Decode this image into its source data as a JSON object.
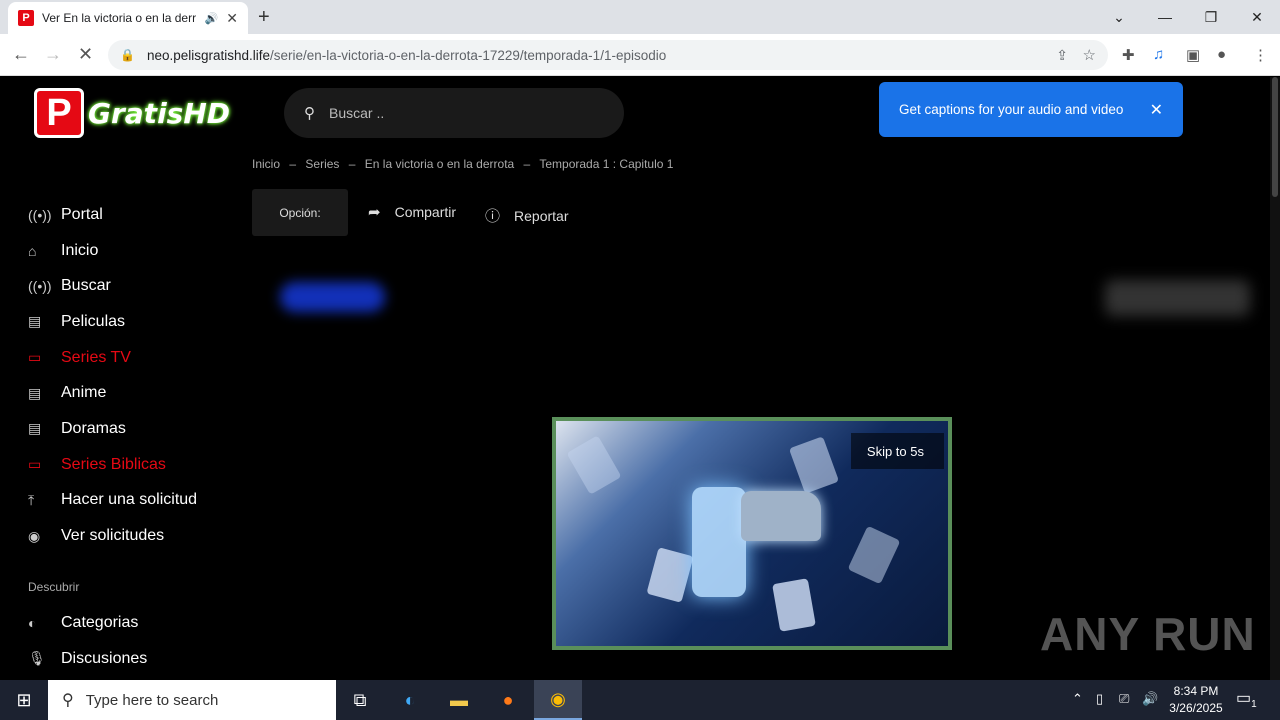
{
  "browser": {
    "tab_title": "Ver En la victoria o en la derr",
    "favicon_letter": "P",
    "url_host": "neo.pelisgratishd.life",
    "url_path": "/serie/en-la-victoria-o-en-la-derrota-17229/temporada-1/1-episodio"
  },
  "site": {
    "logo_letter": "P",
    "logo_text": "GratisHD",
    "search_placeholder": "Buscar .."
  },
  "popup": {
    "text": "Get captions for your audio and video"
  },
  "breadcrumb": [
    "Inicio",
    "–",
    "Series",
    "–",
    "En la victoria o en la derrota",
    "–",
    "Temporada 1 : Capitulo 1"
  ],
  "actions": {
    "option_label": "Opción:",
    "share_label": "Compartir",
    "report_label": "Reportar"
  },
  "sidebar": {
    "items": [
      {
        "label": "Portal",
        "icon": "broadcast-icon",
        "active": false
      },
      {
        "label": "Inicio",
        "icon": "home-icon",
        "active": false
      },
      {
        "label": "Buscar",
        "icon": "broadcast-icon",
        "active": false
      },
      {
        "label": "Peliculas",
        "icon": "film-icon",
        "active": false
      },
      {
        "label": "Series TV",
        "icon": "tv-icon",
        "active": true
      },
      {
        "label": "Anime",
        "icon": "film-icon",
        "active": false
      },
      {
        "label": "Doramas",
        "icon": "film-icon",
        "active": false
      },
      {
        "label": "Series Biblicas",
        "icon": "tv-icon",
        "active": true
      },
      {
        "label": "Hacer una solicitud",
        "icon": "upload-icon",
        "active": false
      },
      {
        "label": "Ver solicitudes",
        "icon": "eye-icon",
        "active": false
      }
    ],
    "section_label": "Descubrir",
    "discover": [
      {
        "label": "Categorias",
        "icon": "halfcircle-icon"
      },
      {
        "label": "Discusiones",
        "icon": "mic-icon"
      }
    ]
  },
  "ad": {
    "skip_label": "Skip to 5s"
  },
  "watermark": "ANY RUN",
  "taskbar": {
    "search_placeholder": "Type here to search",
    "time": "8:34 PM",
    "date": "3/26/2025",
    "notification_count": "1"
  },
  "colors": {
    "accent_red": "#e50914",
    "popup_blue": "#1a73e8"
  }
}
